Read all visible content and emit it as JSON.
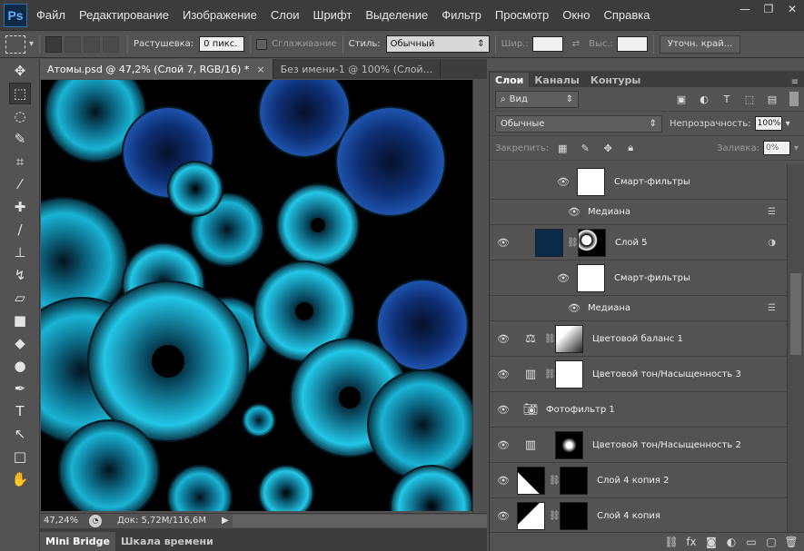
{
  "app": {
    "logo": "Ps"
  },
  "menu": [
    "Файл",
    "Редактирование",
    "Изображение",
    "Слои",
    "Шрифт",
    "Выделение",
    "Фильтр",
    "Просмотр",
    "Окно",
    "Справка"
  ],
  "options": {
    "feather_label": "Растушевка:",
    "feather_value": "0 пикс.",
    "antialias_label": "Сглаживание",
    "style_label": "Стиль:",
    "style_value": "Обычный",
    "width_label": "Шир.:",
    "height_label": "Выс.:",
    "refine_label": "Уточн. край..."
  },
  "tabs": [
    {
      "label": "Атомы.psd @ 47,2% (Слой 7, RGB/16) *"
    },
    {
      "label": "Без имени-1 @ 100% (Слой..."
    }
  ],
  "status": {
    "zoom": "47,24%",
    "doc": "Док: 5,72M/116,6M"
  },
  "bottom_tabs": [
    "Mini Bridge",
    "Шкала времени"
  ],
  "panel": {
    "tabs": [
      "Слои",
      "Каналы",
      "Контуры"
    ],
    "filter_kind": "Вид",
    "blend_mode": "Обычные",
    "opacity_label": "Непрозрачность:",
    "opacity_value": "100%",
    "lock_label": "Закрепить:",
    "fill_label": "Заливка:",
    "fill_value": "0%"
  },
  "layers": [
    {
      "name": "Смарт-фильтры",
      "type": "smart",
      "thumb": "white"
    },
    {
      "name": "Медиана",
      "type": "filter"
    },
    {
      "name": "Слой 5",
      "type": "smart_obj"
    },
    {
      "name": "Смарт-фильтры",
      "type": "smart",
      "thumb": "white"
    },
    {
      "name": "Медиана",
      "type": "filter"
    },
    {
      "name": "Цветовой баланс 1",
      "type": "adj",
      "icon": "balance"
    },
    {
      "name": "Цветовой тон/Насыщенность 3",
      "type": "adj",
      "icon": "hue"
    },
    {
      "name": "Фотофильтр 1",
      "type": "photofilter"
    },
    {
      "name": "Цветовой тон/Насыщенность 2",
      "type": "adj",
      "icon": "hue"
    },
    {
      "name": "Слой 4 копия 2",
      "type": "masked"
    },
    {
      "name": "Слой 4 копия",
      "type": "masked"
    }
  ]
}
